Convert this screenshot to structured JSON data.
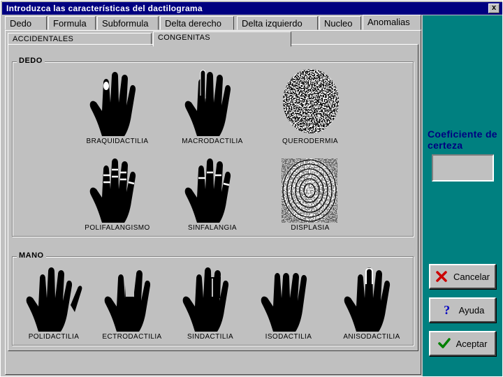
{
  "window": {
    "title": "Introduzca las características del dactilograma",
    "close_glyph": "x"
  },
  "tabs": [
    {
      "label": "Dedo"
    },
    {
      "label": "Formula"
    },
    {
      "label": "Subformula"
    },
    {
      "label": "Delta derecho"
    },
    {
      "label": "Delta izquierdo"
    },
    {
      "label": "Nucleo"
    },
    {
      "label": "Anomalias",
      "active": true
    }
  ],
  "subtabs": [
    {
      "label": "ACCIDENTALES"
    },
    {
      "label": "CONGENITAS",
      "active": true
    }
  ],
  "dedo": {
    "legend": "DEDO",
    "items": [
      {
        "label": "BRAQUIDACTILIA",
        "icon": "hand-short-thumb"
      },
      {
        "label": "MACRODACTILIA",
        "icon": "hand-enlarged-finger"
      },
      {
        "label": "QUERODERMIA",
        "icon": "fingerprint-patchy"
      },
      {
        "label": "POLIFALANGISMO",
        "icon": "hand-extra-phalanges"
      },
      {
        "label": "SINFALANGIA",
        "icon": "hand-fused-phalanges"
      },
      {
        "label": "DISPLASIA",
        "icon": "fingerprint-dysplasia"
      }
    ]
  },
  "mano": {
    "legend": "MANO",
    "items": [
      {
        "label": "POLIDACTILIA",
        "icon": "hand-extra-finger"
      },
      {
        "label": "ECTRODACTILIA",
        "icon": "hand-missing-finger"
      },
      {
        "label": "SINDACTILIA",
        "icon": "hand-webbed-fingers"
      },
      {
        "label": "ISODACTILIA",
        "icon": "hand-equal-fingers"
      },
      {
        "label": "ANISODACTILIA",
        "icon": "hand-unequal-fingers"
      }
    ]
  },
  "side": {
    "coef_label": "Coeficiente de certeza",
    "coef_value": "",
    "cancel_label": "Cancelar",
    "help_label": "Ayuda",
    "accept_label": "Aceptar",
    "colors": {
      "panel": "#008080",
      "title_text": "#000080",
      "cancel_icon": "#cc0000",
      "help_icon": "#0000c0",
      "accept_icon": "#008000"
    }
  }
}
